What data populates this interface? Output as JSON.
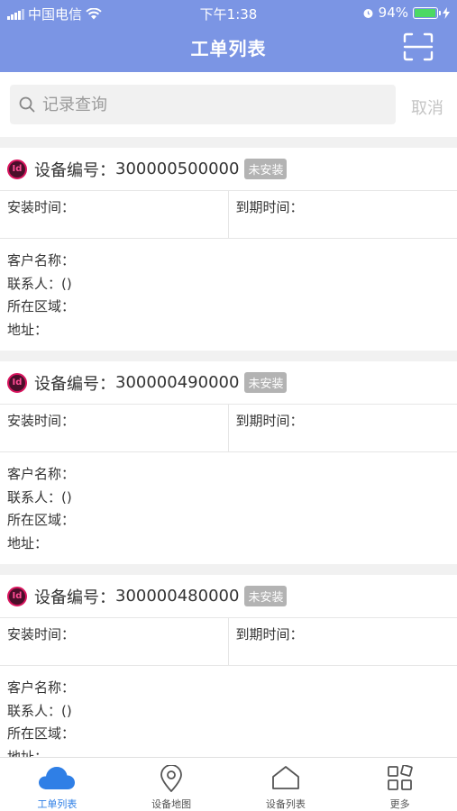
{
  "status_bar": {
    "carrier": "中国电信",
    "time": "下午1:38",
    "battery": "94%"
  },
  "nav": {
    "title": "工单列表"
  },
  "search": {
    "placeholder": "记录查询",
    "cancel_label": "取消"
  },
  "labels": {
    "device_no": "设备编号：",
    "install_time": "安装时间：",
    "expire_time": "到期时间：",
    "customer_name": "客户名称：",
    "contact": "联系人：()",
    "region": "所在区域：",
    "address": "地址："
  },
  "cards": [
    {
      "device_no": "300000500000",
      "status": "未安装"
    },
    {
      "device_no": "300000490000",
      "status": "未安装"
    },
    {
      "device_no": "300000480000",
      "status": "未安装"
    }
  ],
  "tabs": [
    {
      "label": "工单列表",
      "icon": "cloud-icon",
      "active": true
    },
    {
      "label": "设备地图",
      "icon": "map-pin-icon",
      "active": false
    },
    {
      "label": "设备列表",
      "icon": "home-icon",
      "active": false
    },
    {
      "label": "更多",
      "icon": "grid-icon",
      "active": false
    }
  ],
  "colors": {
    "header": "#7b95e4",
    "active_tab": "#2f7fe6",
    "badge": "#b3b3b3",
    "battery": "#4cd964"
  }
}
